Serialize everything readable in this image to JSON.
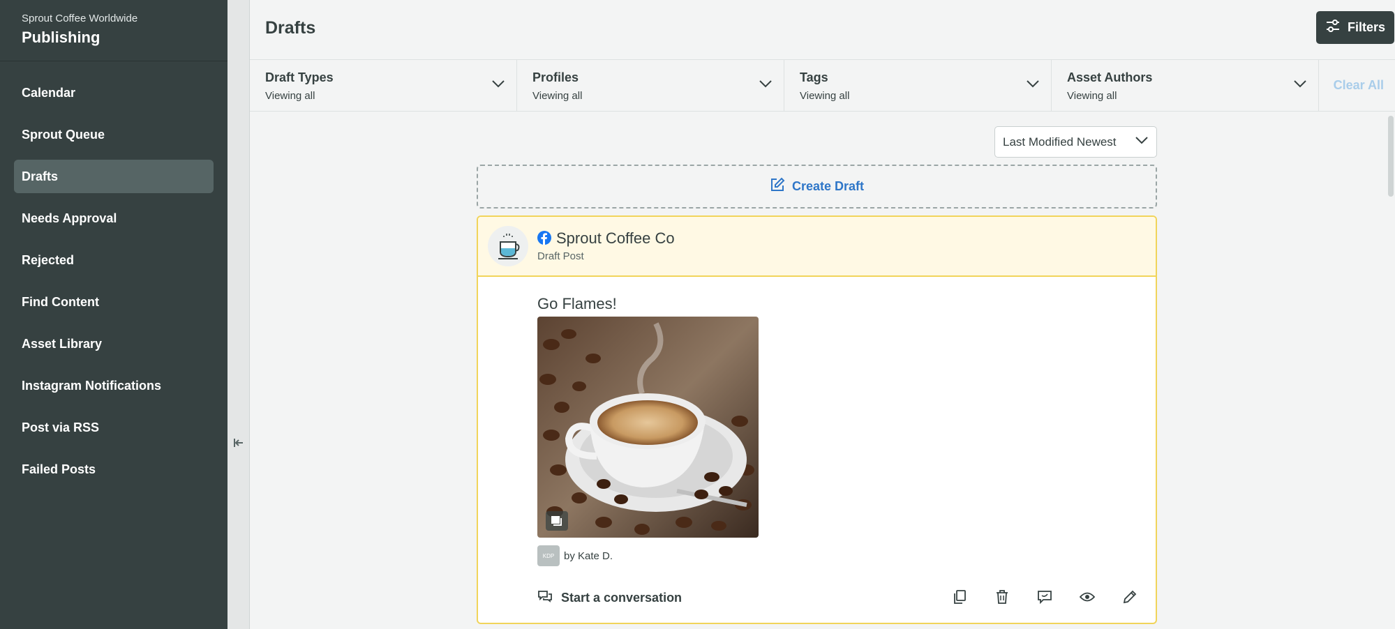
{
  "sidebar": {
    "org_name": "Sprout Coffee Worldwide",
    "app_title": "Publishing",
    "items": [
      {
        "label": "Calendar"
      },
      {
        "label": "Sprout Queue"
      },
      {
        "label": "Drafts",
        "active": true
      },
      {
        "label": "Needs Approval"
      },
      {
        "label": "Rejected"
      },
      {
        "label": "Find Content"
      },
      {
        "label": "Asset Library"
      },
      {
        "label": "Instagram Notifications"
      },
      {
        "label": "Post via RSS"
      },
      {
        "label": "Failed Posts"
      }
    ]
  },
  "header": {
    "title": "Drafts",
    "filters_label": "Filters"
  },
  "filterbar": {
    "filters": [
      {
        "title": "Draft Types",
        "value": "Viewing all"
      },
      {
        "title": "Profiles",
        "value": "Viewing all"
      },
      {
        "title": "Tags",
        "value": "Viewing all"
      },
      {
        "title": "Asset Authors",
        "value": "Viewing all"
      }
    ],
    "clear_all": "Clear All"
  },
  "sort": {
    "selected": "Last Modified Newest"
  },
  "create_draft": {
    "label": "Create Draft"
  },
  "draft_card": {
    "profile_name": "Sprout Coffee Co",
    "network": "facebook",
    "post_type": "Draft Post",
    "text": "Go Flames!",
    "author_initials": "KDP",
    "author": "by Kate D.",
    "conversation_label": "Start a conversation",
    "actions": [
      "copy-icon",
      "trash-icon",
      "comment-icon",
      "eye-icon",
      "pencil-icon"
    ]
  },
  "colors": {
    "sidebar_bg": "#364141",
    "active_nav": "#566565",
    "accent_blue": "#2e76c8",
    "card_border": "#f1d45a",
    "card_header_bg": "#fff9e4"
  }
}
